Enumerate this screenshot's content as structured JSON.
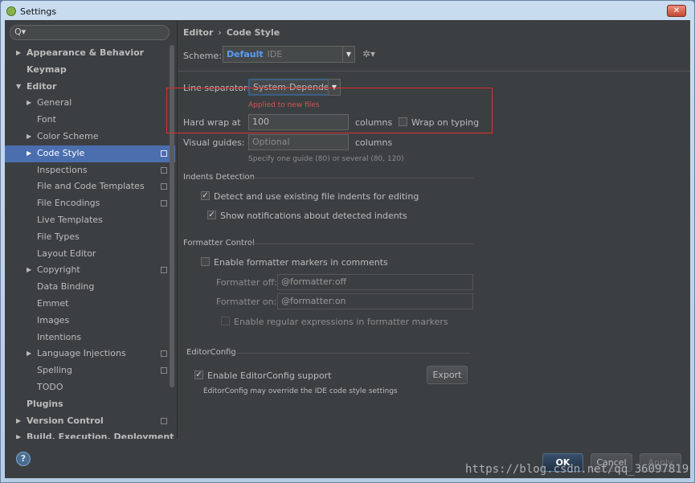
{
  "window": {
    "title": "Settings",
    "close_label": "✕"
  },
  "search": {
    "icon": "Q▾"
  },
  "sidebar": {
    "items": [
      {
        "label": "Appearance & Behavior",
        "indent": 0,
        "arrow": "▶",
        "bold": true,
        "copy": false
      },
      {
        "label": "Keymap",
        "indent": 0,
        "arrow": "",
        "bold": true,
        "copy": false
      },
      {
        "label": "Editor",
        "indent": 0,
        "arrow": "▼",
        "bold": true,
        "copy": false
      },
      {
        "label": "General",
        "indent": 1,
        "arrow": "▶",
        "bold": false,
        "copy": false
      },
      {
        "label": "Font",
        "indent": 1,
        "arrow": "",
        "bold": false,
        "copy": false
      },
      {
        "label": "Color Scheme",
        "indent": 1,
        "arrow": "▶",
        "bold": false,
        "copy": false
      },
      {
        "label": "Code Style",
        "indent": 1,
        "arrow": "▶",
        "bold": false,
        "copy": true,
        "selected": true
      },
      {
        "label": "Inspections",
        "indent": 1,
        "arrow": "",
        "bold": false,
        "copy": true
      },
      {
        "label": "File and Code Templates",
        "indent": 1,
        "arrow": "",
        "bold": false,
        "copy": true
      },
      {
        "label": "File Encodings",
        "indent": 1,
        "arrow": "",
        "bold": false,
        "copy": true
      },
      {
        "label": "Live Templates",
        "indent": 1,
        "arrow": "",
        "bold": false,
        "copy": false
      },
      {
        "label": "File Types",
        "indent": 1,
        "arrow": "",
        "bold": false,
        "copy": false
      },
      {
        "label": "Layout Editor",
        "indent": 1,
        "arrow": "",
        "bold": false,
        "copy": false
      },
      {
        "label": "Copyright",
        "indent": 1,
        "arrow": "▶",
        "bold": false,
        "copy": true
      },
      {
        "label": "Data Binding",
        "indent": 1,
        "arrow": "",
        "bold": false,
        "copy": false
      },
      {
        "label": "Emmet",
        "indent": 1,
        "arrow": "",
        "bold": false,
        "copy": false
      },
      {
        "label": "Images",
        "indent": 1,
        "arrow": "",
        "bold": false,
        "copy": false
      },
      {
        "label": "Intentions",
        "indent": 1,
        "arrow": "",
        "bold": false,
        "copy": false
      },
      {
        "label": "Language Injections",
        "indent": 1,
        "arrow": "▶",
        "bold": false,
        "copy": true
      },
      {
        "label": "Spelling",
        "indent": 1,
        "arrow": "",
        "bold": false,
        "copy": true
      },
      {
        "label": "TODO",
        "indent": 1,
        "arrow": "",
        "bold": false,
        "copy": false
      },
      {
        "label": "Plugins",
        "indent": 0,
        "arrow": "",
        "bold": true,
        "copy": false
      },
      {
        "label": "Version Control",
        "indent": 0,
        "arrow": "▶",
        "bold": true,
        "copy": true
      },
      {
        "label": "Build, Execution, Deployment",
        "indent": 0,
        "arrow": "▶",
        "bold": true,
        "copy": false
      }
    ]
  },
  "breadcrumb": {
    "section": "Editor",
    "separator": "›",
    "page": "Code Style"
  },
  "scheme": {
    "label": "Scheme:",
    "value": "Default",
    "suffix": "IDE",
    "gear": "✲▾"
  },
  "line_separator": {
    "label": "Line separator:",
    "value": "System-Dependent",
    "hint": "Applied to new files"
  },
  "hard_wrap": {
    "label": "Hard wrap at",
    "value": "100",
    "unit": "columns",
    "wrap_on_typing_label": "Wrap on typing",
    "wrap_on_typing_checked": false
  },
  "visual_guides": {
    "label": "Visual guides:",
    "placeholder": "Optional",
    "unit": "columns",
    "hint": "Specify one guide (80) or several (80, 120)"
  },
  "indents_detection": {
    "title": "Indents Detection",
    "detect_label": "Detect and use existing file indents for editing",
    "detect_checked": true,
    "notify_label": "Show notifications about detected indents",
    "notify_checked": true
  },
  "formatter_control": {
    "title": "Formatter Control",
    "enable_label": "Enable formatter markers in comments",
    "enable_checked": false,
    "off_label": "Formatter off:",
    "off_value": "@formatter:off",
    "on_label": "Formatter on:",
    "on_value": "@formatter:on",
    "regex_label": "Enable regular expressions in formatter markers"
  },
  "editorconfig": {
    "title": "EditorConfig",
    "enable_label": "Enable EditorConfig support",
    "enable_checked": true,
    "export_label": "Export",
    "note": "EditorConfig may override the IDE code style settings"
  },
  "footer": {
    "help_icon": "?",
    "ok_label": "OK",
    "cancel_label": "Cancel",
    "apply_label": "Apply"
  },
  "watermark": "https://blog.csdn.net/qq_36097819"
}
